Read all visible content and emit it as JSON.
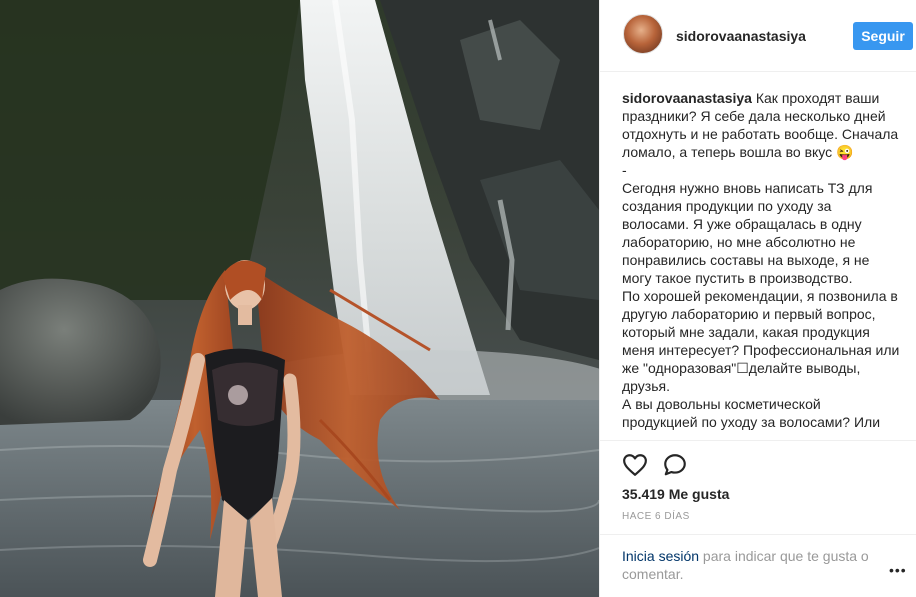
{
  "post": {
    "username": "sidorovaanastasiya",
    "follow_label": "Seguir",
    "caption_user": "sidorovaanastasiya",
    "caption_text": "Как проходят ваши праздники? Я себе дала несколько дней отдохнуть и не работать вообще. Сначала ломало, а теперь вошла во вкус 😜\n-\nСегодня нужно вновь написать ТЗ для создания продукции по уходу за волосами. Я уже обращалась в одну лабораторию, но мне абсолютно не понравились составы на выходе, я не могу такое пустить в производство.\nПо хорошей рекомендации, я позвонила в другую лабораторию и первый вопрос, который мне задали, какая продукция меня интересует? Профессиональная или же \"одноразовая\"☐делайте выводы, друзья.\nА вы довольны косметической продукцией по уходу за волосами? Или",
    "likes": "35.419 Me gusta",
    "time": "HACE 6 DÍAS",
    "login_link": "Inicia sesión",
    "login_rest": " para indicar que te gusta o comentar.",
    "more": "•••"
  },
  "icons": {
    "avatar": "profile-photo",
    "like": "heart-outline-icon",
    "comment": "comment-bubble-icon",
    "more": "more-options-icon"
  },
  "colors": {
    "follow_button": "#3897f0",
    "link": "#003569",
    "muted": "#999999",
    "hair": "#b5532a"
  }
}
